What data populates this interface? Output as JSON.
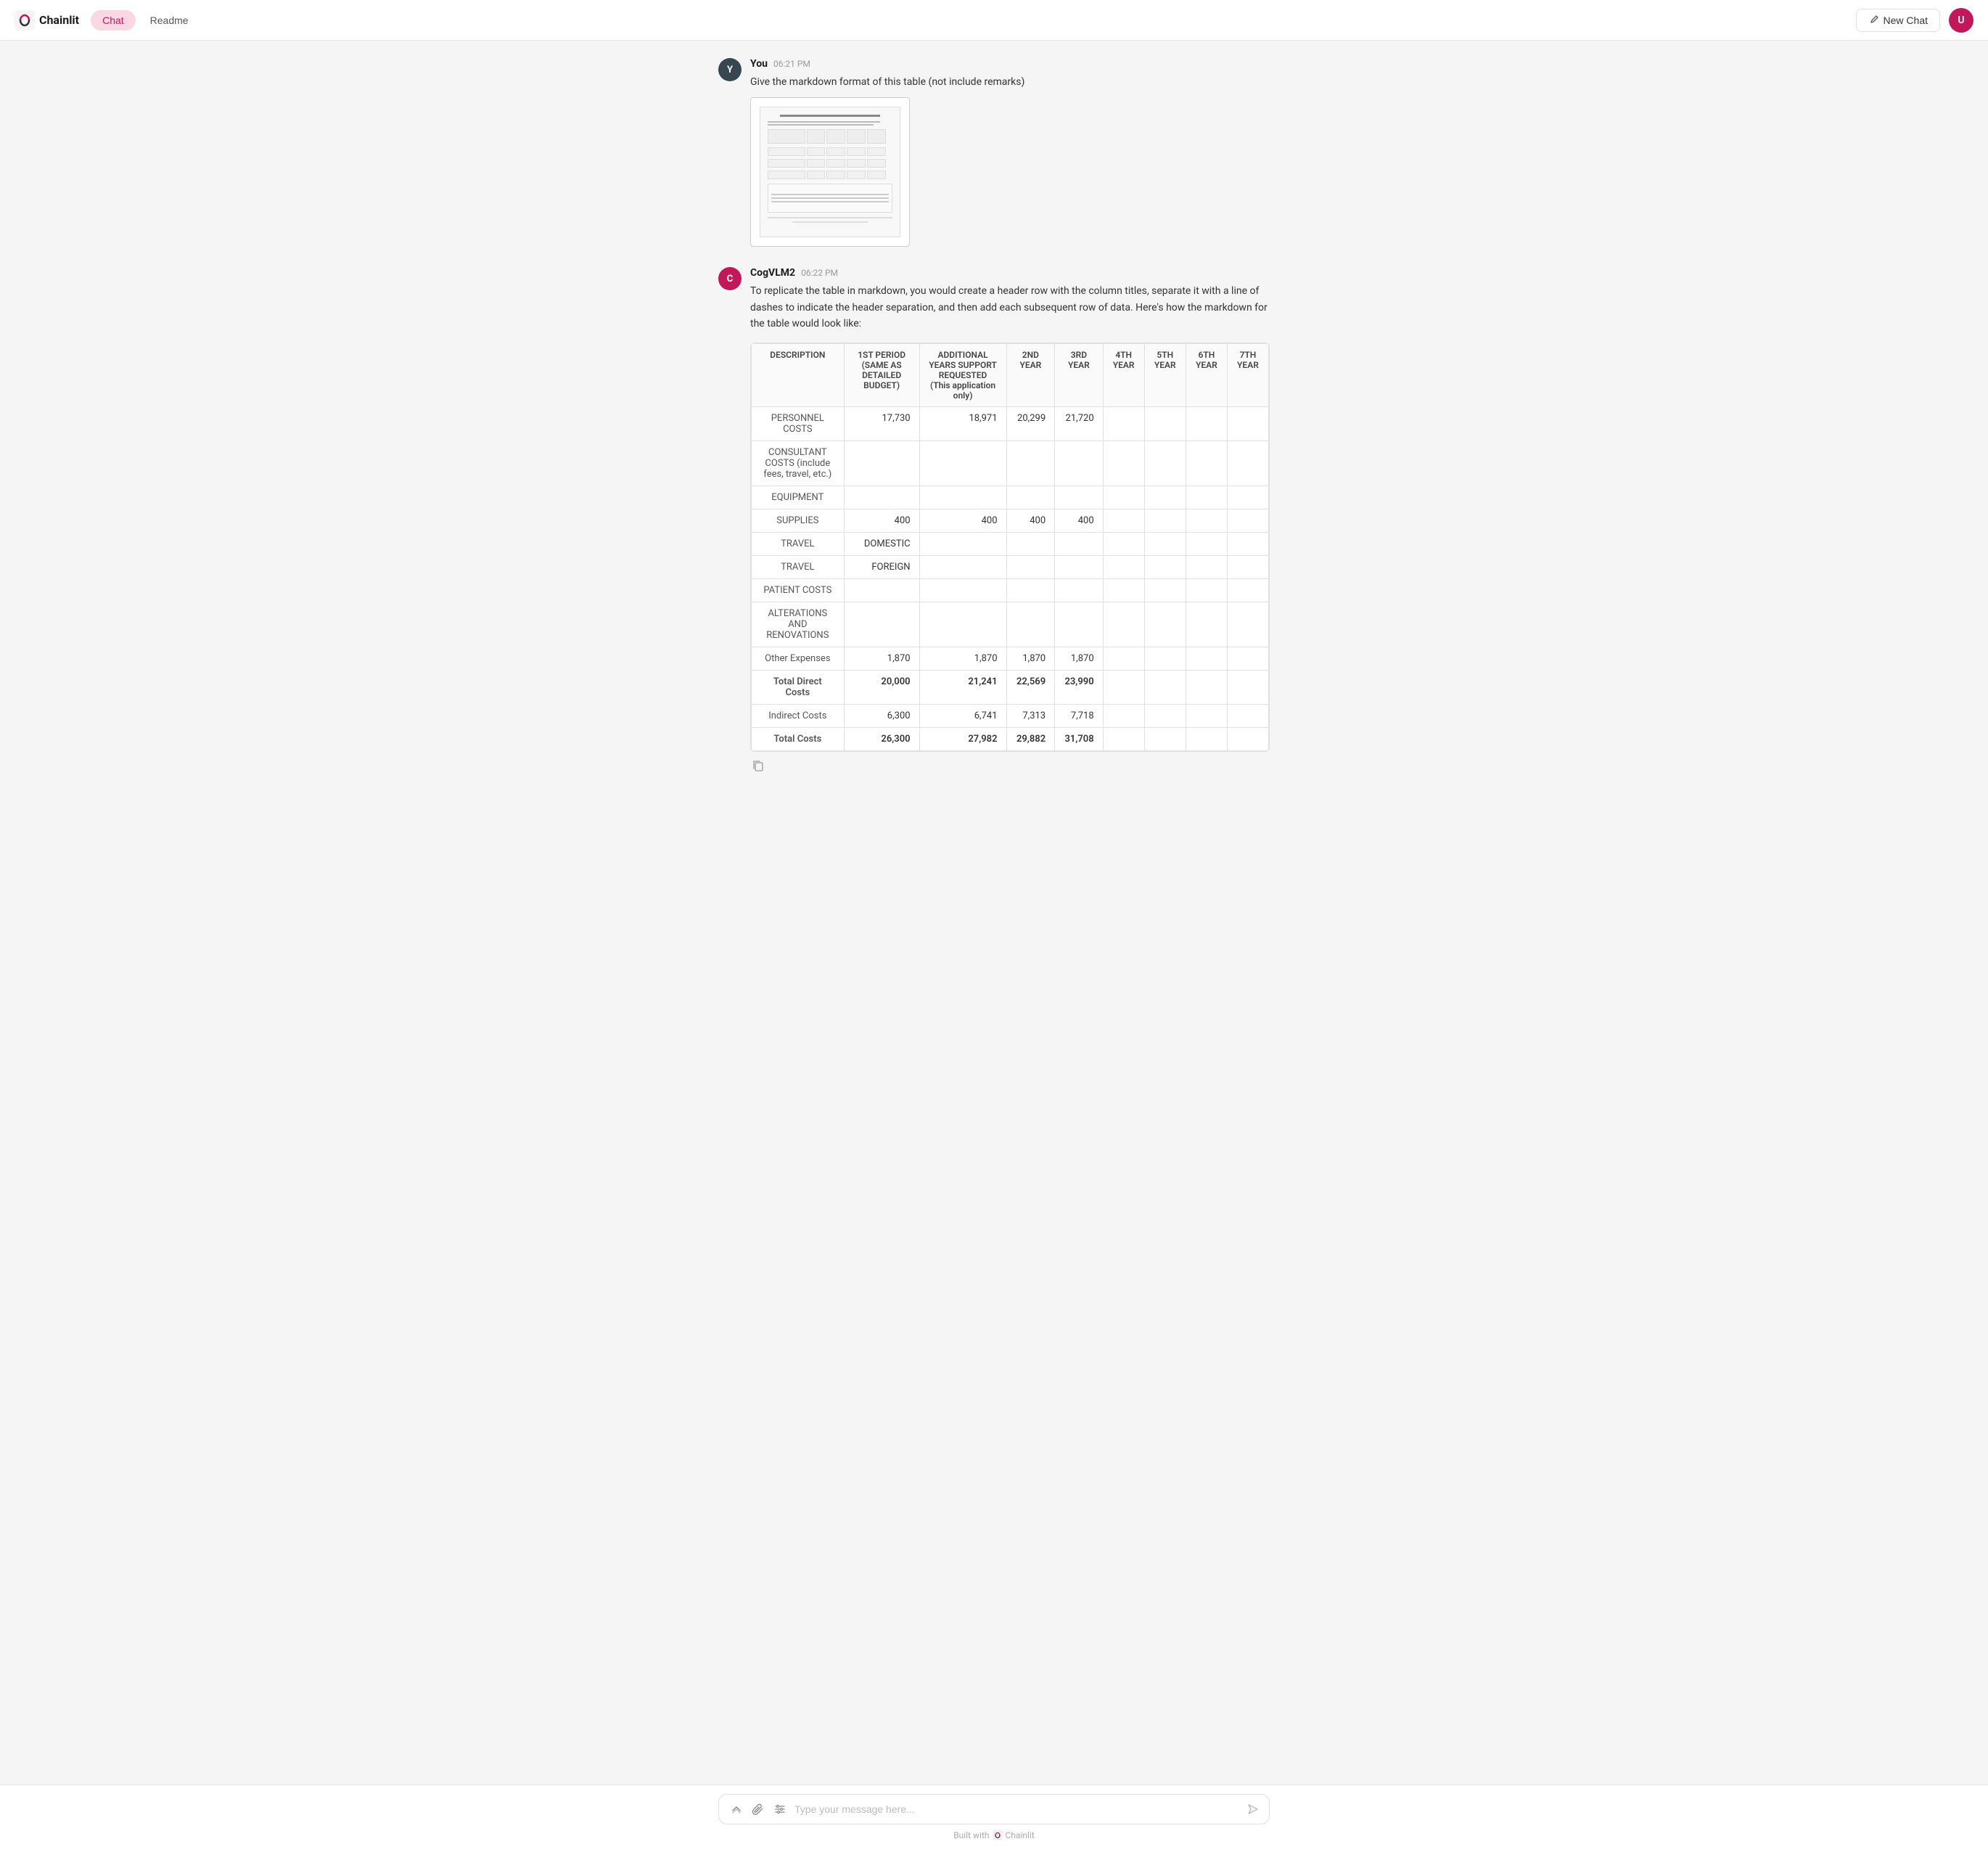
{
  "header": {
    "logo_text": "Chainlit",
    "tabs": [
      {
        "id": "chat",
        "label": "Chat",
        "active": true
      },
      {
        "id": "readme",
        "label": "Readme",
        "active": false
      }
    ],
    "new_chat_label": "New Chat",
    "avatar_initial": "U"
  },
  "messages": [
    {
      "id": "msg1",
      "sender": "You",
      "sender_initial": "Y",
      "sender_type": "you",
      "time": "06:21 PM",
      "text": "Give the markdown format of this table (not include remarks)",
      "has_image": true
    },
    {
      "id": "msg2",
      "sender": "CogVLM2",
      "sender_initial": "C",
      "sender_type": "bot",
      "time": "06:22 PM",
      "text": "To replicate the table in markdown, you would create a header row with the column titles, separate it with a line of dashes to indicate the header separation, and then add each subsequent row of data. Here's how the markdown for the table would look like:",
      "has_table": true
    }
  ],
  "table": {
    "headers": [
      "DESCRIPTION",
      "1ST PERIOD (SAME AS DETAILED BUDGET)",
      "ADDITIONAL YEARS SUPPORT REQUESTED (This application only)",
      "2ND YEAR",
      "3RD YEAR",
      "4TH YEAR",
      "5TH YEAR",
      "6TH YEAR",
      "7TH YEAR"
    ],
    "rows": [
      {
        "desc": "PERSONNEL COSTS",
        "col1": "17,730",
        "col2": "18,971",
        "col3": "20,299",
        "col4": "21,720",
        "col5": "",
        "col6": "",
        "col7": "",
        "col8": ""
      },
      {
        "desc": "CONSULTANT COSTS\n(include fees, travel, etc.)",
        "col1": "",
        "col2": "",
        "col3": "",
        "col4": "",
        "col5": "",
        "col6": "",
        "col7": "",
        "col8": ""
      },
      {
        "desc": "EQUIPMENT",
        "col1": "",
        "col2": "",
        "col3": "",
        "col4": "",
        "col5": "",
        "col6": "",
        "col7": "",
        "col8": ""
      },
      {
        "desc": "SUPPLIES",
        "col1": "400",
        "col2": "400",
        "col3": "400",
        "col4": "400",
        "col5": "",
        "col6": "",
        "col7": "",
        "col8": ""
      },
      {
        "desc": "TRAVEL",
        "col1": "DOMESTIC",
        "col2": "",
        "col3": "",
        "col4": "",
        "col5": "",
        "col6": "",
        "col7": "",
        "col8": ""
      },
      {
        "desc": "TRAVEL",
        "col1": "FOREIGN",
        "col2": "",
        "col3": "",
        "col4": "",
        "col5": "",
        "col6": "",
        "col7": "",
        "col8": ""
      },
      {
        "desc": "PATIENT COSTS",
        "col1": "",
        "col2": "",
        "col3": "",
        "col4": "",
        "col5": "",
        "col6": "",
        "col7": "",
        "col8": ""
      },
      {
        "desc": "ALTERATIONS AND RENOVATIONS",
        "col1": "",
        "col2": "",
        "col3": "",
        "col4": "",
        "col5": "",
        "col6": "",
        "col7": "",
        "col8": ""
      },
      {
        "desc": "Other Expenses",
        "col1": "1,870",
        "col2": "1,870",
        "col3": "1,870",
        "col4": "1,870",
        "col5": "",
        "col6": "",
        "col7": "",
        "col8": ""
      },
      {
        "desc": "Total Direct Costs",
        "col1": "20,000",
        "col2": "21,241",
        "col3": "22,569",
        "col4": "23,990",
        "col5": "",
        "col6": "",
        "col7": "",
        "col8": ""
      },
      {
        "desc": "Indirect Costs",
        "col1": "6,300",
        "col2": "6,741",
        "col3": "7,313",
        "col4": "7,718",
        "col5": "",
        "col6": "",
        "col7": "",
        "col8": ""
      },
      {
        "desc": "Total Costs",
        "col1": "26,300",
        "col2": "27,982",
        "col3": "29,882",
        "col4": "31,708",
        "col5": "",
        "col6": "",
        "col7": "",
        "col8": ""
      }
    ]
  },
  "input": {
    "placeholder": "Type your message here...",
    "value": ""
  },
  "footer": {
    "built_with_text": "Built with",
    "brand": "Chainlit"
  }
}
